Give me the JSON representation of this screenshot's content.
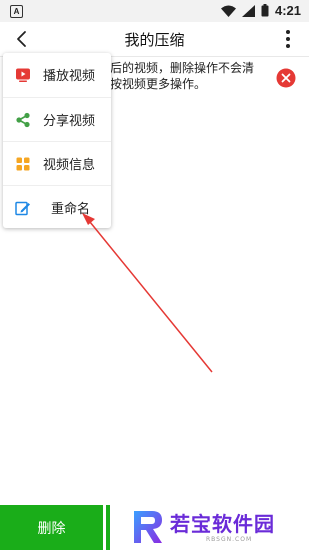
{
  "status_bar": {
    "app_badge": "A",
    "time": "4:21"
  },
  "toolbar": {
    "title": "我的压缩"
  },
  "notice": {
    "text": "后的视频，删除操作不会清\n按视频更多操作。"
  },
  "menu": {
    "items": [
      {
        "label": "播放视频",
        "icon": "play-video-icon",
        "color": "#e53935"
      },
      {
        "label": "分享视频",
        "icon": "share-icon",
        "color": "#43a047"
      },
      {
        "label": "视频信息",
        "icon": "info-grid-icon",
        "color": "#f5a623"
      },
      {
        "label": "重命名",
        "icon": "edit-icon",
        "color": "#1e88e5"
      }
    ]
  },
  "bottom": {
    "delete_label": "删除"
  },
  "watermark": {
    "text": "若宝软件园",
    "sub": "RBSGN.COM"
  },
  "colors": {
    "accent_green": "#1aad19",
    "arrow_red": "#e53935",
    "close_red": "#e53935"
  }
}
